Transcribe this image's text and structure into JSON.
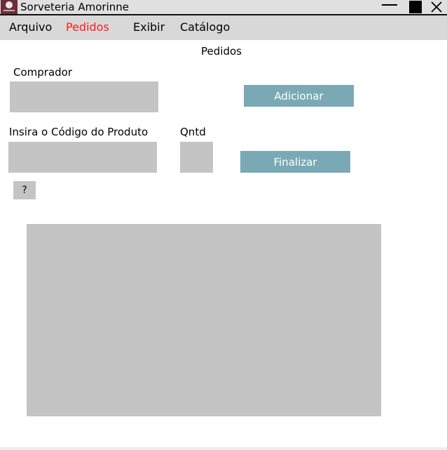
{
  "window": {
    "title": "Sorveteria Amorinne",
    "icon": "app-logo-icon",
    "controls": {
      "minimize": "minimize-icon",
      "maximize": "maximize-icon",
      "close": "close-icon"
    }
  },
  "menu": {
    "items": [
      {
        "label": "Arquivo"
      },
      {
        "label": "Pedidos",
        "active": true,
        "color": "#ff1a1a"
      },
      {
        "label": "Exibir"
      },
      {
        "label": "Catálogo"
      }
    ]
  },
  "page": {
    "title": "Pedidos"
  },
  "form": {
    "buyer_label": "Comprador",
    "buyer_value": "",
    "product_code_label": "Insira o Código do Produto",
    "product_code_value": "",
    "quantity_label": "Qntd",
    "quantity_value": "",
    "add_button": "Adicionar",
    "finish_button": "Finalizar",
    "help_button": "?"
  },
  "colors": {
    "accent_button": "#7aa9b5",
    "field_background": "#c4c4c4",
    "menubar_background": "#d9d8d8",
    "active_menu": "#ff1a1a"
  },
  "orders_table": {
    "rows": []
  }
}
